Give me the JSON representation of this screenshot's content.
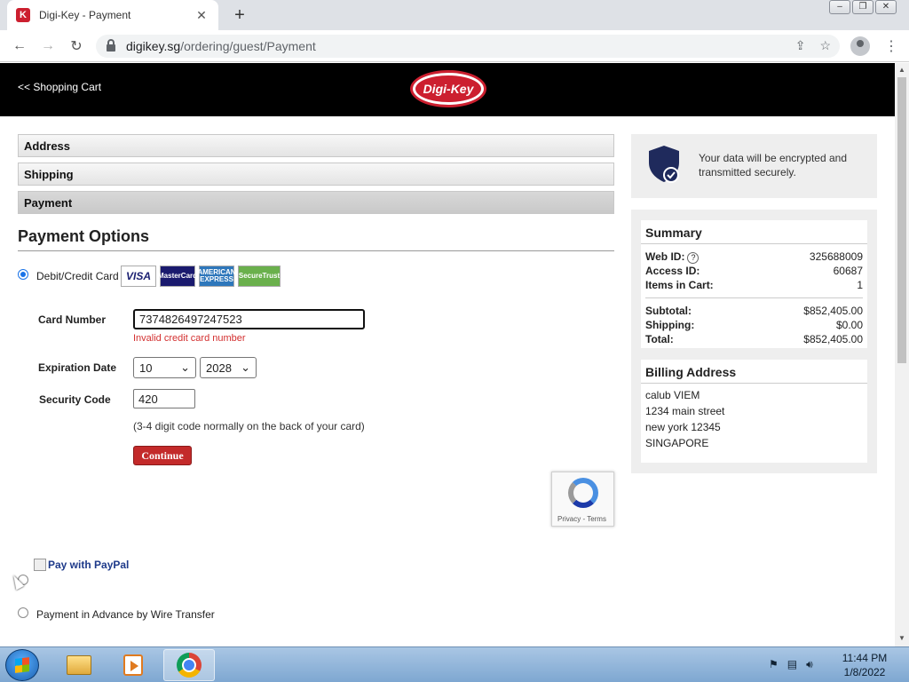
{
  "browser": {
    "tab_title": "Digi-Key - Payment",
    "favicon_letter": "K",
    "url_host": "digikey.sg",
    "url_path": "/ordering/guest/Payment"
  },
  "header": {
    "back_link": "<< Shopping Cart",
    "logo_text": "Digi-Key"
  },
  "steps": [
    "Address",
    "Shipping",
    "Payment"
  ],
  "payment": {
    "title": "Payment Options",
    "option_card": "Debit/Credit Card",
    "cards": [
      "VISA",
      "MasterCard",
      "AMERICAN EXPRESS",
      "SecureTrust"
    ],
    "card_number_label": "Card Number",
    "card_number_value": "7374826497247523",
    "card_error": "Invalid credit card number",
    "expiration_label": "Expiration Date",
    "exp_month": "10",
    "exp_year": "2028",
    "security_label": "Security Code",
    "security_value": "420",
    "security_hint": "(3-4 digit code normally on the back of your card)",
    "continue_label": "Continue",
    "recaptcha_text": "Privacy - Terms",
    "paypal_label": "Pay with PayPal",
    "option_wire": "Payment in Advance by Wire Transfer"
  },
  "sidebar": {
    "secure_text": "Your data will be encrypted and transmitted securely.",
    "summary_title": "Summary",
    "web_id_label": "Web ID:",
    "web_id": "325688009",
    "access_id_label": "Access ID:",
    "access_id": "60687",
    "items_label": "Items in Cart:",
    "items": "1",
    "subtotal_label": "Subtotal:",
    "subtotal": "$852,405.00",
    "shipping_label": "Shipping:",
    "shipping": "$0.00",
    "total_label": "Total:",
    "total": "$852,405.00",
    "billing_title": "Billing Address",
    "billing_lines": [
      "calub VIEM",
      "1234 main street",
      "new york 12345",
      "SINGAPORE"
    ]
  },
  "taskbar": {
    "time": "11:44 PM",
    "date": "1/8/2022"
  },
  "colors": {
    "brand_red": "#cc1f2f",
    "continue_red": "#c32a2a",
    "error_red": "#d32f2f"
  }
}
